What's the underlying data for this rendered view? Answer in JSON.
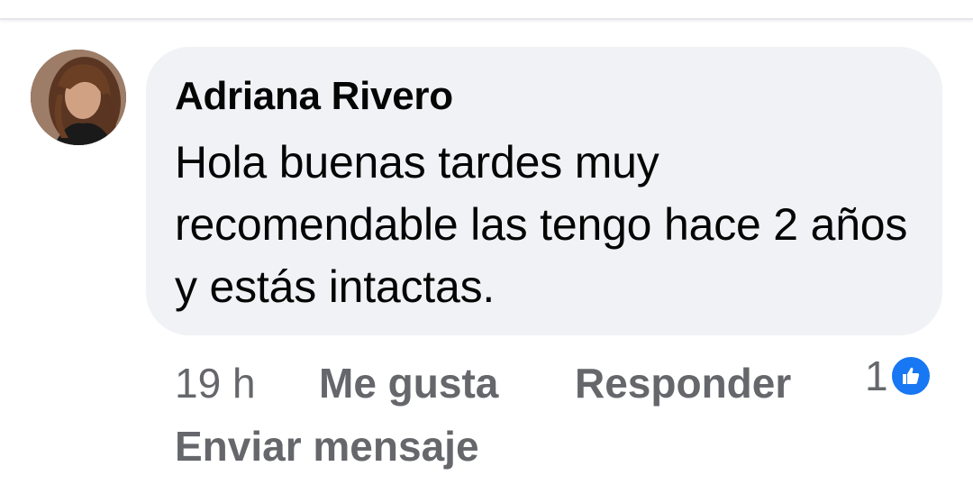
{
  "comment": {
    "author": "Adriana Rivero",
    "text": "Hola buenas tardes muy recomendable las tengo hace 2 años y estás intactas.",
    "time": "19 h",
    "like_label": "Me gusta",
    "reply_label": "Responder",
    "reaction_count": "1",
    "reaction_icon": "thumbs-up-icon",
    "send_message_label": "Enviar mensaje"
  },
  "colors": {
    "bubble": "#f0f2f5",
    "text": "#050505",
    "secondary_text": "#65676b",
    "like_blue": "#1877f2"
  }
}
